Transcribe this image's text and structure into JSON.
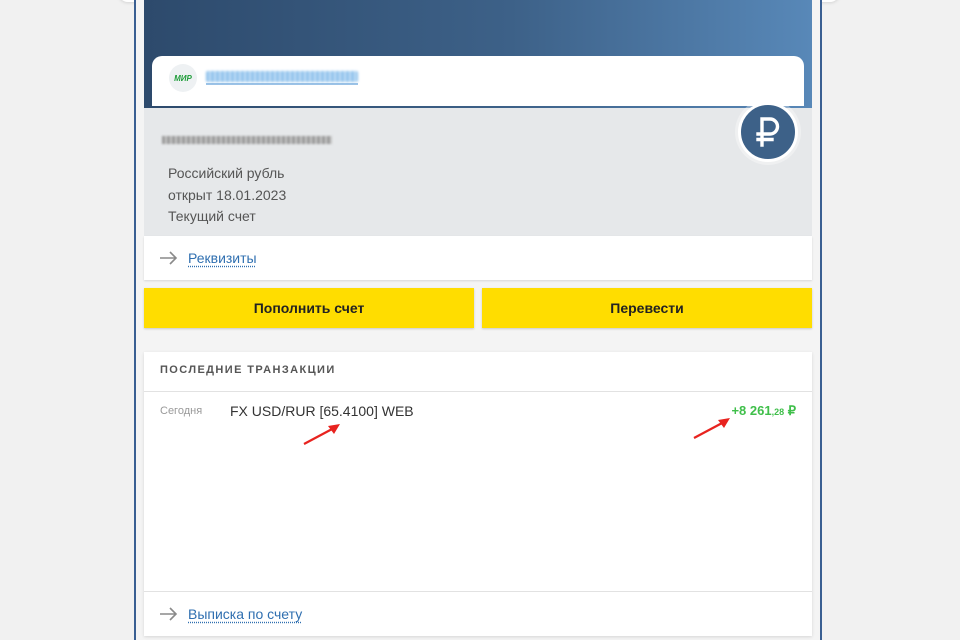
{
  "card": {
    "payment_system": "МИР"
  },
  "account": {
    "currency": "Российский рубль",
    "opened": "открыт 18.01.2023",
    "type": "Текущий счет",
    "currency_icon": "ruble-icon",
    "details_link": "Реквизиты"
  },
  "actions": {
    "top_up": "Пополнить счет",
    "transfer": "Перевести"
  },
  "transactions": {
    "title": "ПОСЛЕДНИЕ ТРАНЗАКЦИИ",
    "items": [
      {
        "date": "Сегодня",
        "description": "FX USD/RUR [65.4100] WEB",
        "amount_main": "+8 261",
        "amount_kop": ",28",
        "currency": "₽"
      }
    ],
    "statement_link": "Выписка по счету"
  },
  "colors": {
    "accent_yellow": "#ffdd00",
    "brand_blue": "#3d6188",
    "positive_green": "#3fbf4a",
    "link_blue": "#2f6fb0",
    "annotation_red": "#e8231f"
  }
}
